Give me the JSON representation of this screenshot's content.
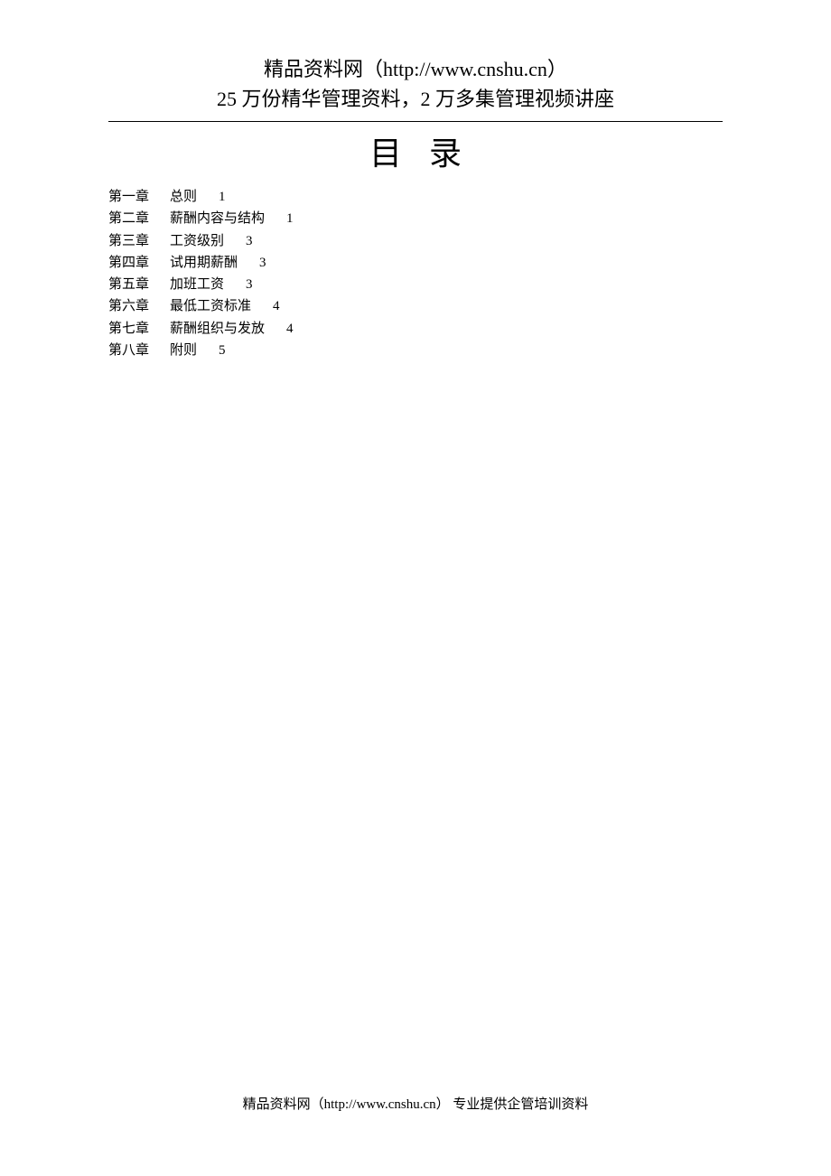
{
  "header": {
    "line1": "精品资料网（http://www.cnshu.cn）",
    "line2": "25 万份精华管理资料，2 万多集管理视频讲座"
  },
  "title": {
    "char1": "目",
    "char2": "录"
  },
  "toc": [
    {
      "chapter": "第一章",
      "name": "总则",
      "page": "1"
    },
    {
      "chapter": "第二章",
      "name": "薪酬内容与结构",
      "page": "1"
    },
    {
      "chapter": "第三章",
      "name": "工资级别",
      "page": "3"
    },
    {
      "chapter": "第四章",
      "name": "试用期薪酬",
      "page": "3"
    },
    {
      "chapter": "第五章",
      "name": "加班工资",
      "page": "3"
    },
    {
      "chapter": "第六章",
      "name": "最低工资标准",
      "page": "4"
    },
    {
      "chapter": "第七章",
      "name": "薪酬组织与发放",
      "page": "4"
    },
    {
      "chapter": "第八章",
      "name": "附则",
      "page": "5"
    }
  ],
  "footer": "精品资料网（http://www.cnshu.cn）  专业提供企管培训资料"
}
